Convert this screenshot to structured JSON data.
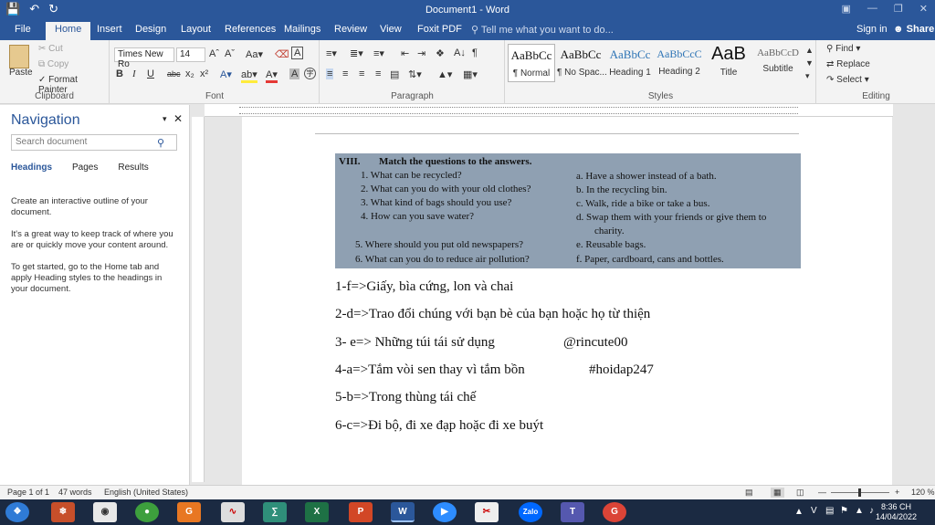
{
  "window": {
    "title": "Document1 - Word"
  },
  "quick_access": {
    "save_icon": "save-icon",
    "undo_icon": "undo-icon",
    "redo_icon": "redo-icon"
  },
  "tabs": [
    "File",
    "Home",
    "Insert",
    "Design",
    "Layout",
    "References",
    "Mailings",
    "Review",
    "View",
    "Foxit PDF"
  ],
  "tell_me": "Tell me what you want to do...",
  "signin": "Sign in",
  "share": "Share",
  "clipboard": {
    "paste": "Paste",
    "cut": "Cut",
    "copy": "Copy",
    "format_painter": "Format Painter",
    "label": "Clipboard"
  },
  "font": {
    "name": "Times New Ro",
    "size": "14",
    "label": "Font"
  },
  "paragraph": {
    "label": "Paragraph"
  },
  "styles": {
    "label": "Styles",
    "items": [
      {
        "sample": "AaBbCc",
        "name": "¶ Normal"
      },
      {
        "sample": "AaBbCc",
        "name": "¶ No Spac..."
      },
      {
        "sample": "AaBbCc",
        "name": "Heading 1"
      },
      {
        "sample": "AaBbCcC",
        "name": "Heading 2"
      },
      {
        "sample": "AaB",
        "name": "Title"
      },
      {
        "sample": "AaBbCcD",
        "name": "Subtitle"
      }
    ]
  },
  "editing": {
    "find": "Find",
    "replace": "Replace",
    "select": "Select",
    "label": "Editing"
  },
  "navigation": {
    "title": "Navigation",
    "search_placeholder": "Search document",
    "tabs": [
      "Headings",
      "Pages",
      "Results"
    ],
    "p1": "Create an interactive outline of your document.",
    "p2": "It's a great way to keep track of where you are or quickly move your content around.",
    "p3": "To get started, go to the Home tab and apply Heading styles to the headings in your document."
  },
  "photo": {
    "heading_num": "VIII.",
    "heading": "Match the questions to the answers.",
    "questions": [
      "1.   What can be recycled?",
      "2.   What can you do with your old clothes?",
      "3.   What kind of bags should you use?",
      "4.   How can you save water?",
      "5.   Where should you put old newspapers?",
      "6.   What can you do to reduce air pollution?"
    ],
    "answers": [
      "a.   Have a shower instead of a bath.",
      "b.   In the recycling bin.",
      "c.   Walk, ride a bike or take a bus.",
      "d.   Swap them with your friends or give them to",
      "charity.",
      "e.   Reusable bags.",
      "f.   Paper, cardboard, cans and bottles."
    ]
  },
  "document_lines": [
    "1-f=>Giấy, bìa cứng, lon và chai",
    "2-d=>Trao đổi chúng với bạn bè của bạn hoặc họ từ thiện",
    "3- e=> Những túi tái sử dụng",
    "4-a=>Tắm vòi sen thay vì tắm bồn",
    "5-b=>Trong thùng tái chế",
    "6-c=>Đi bộ, đi xe đạp hoặc đi xe buýt"
  ],
  "tags": {
    "tag1": "@rincute00",
    "tag2": "#hoidap247"
  },
  "status": {
    "page": "Page 1 of 1",
    "words": "47 words",
    "lang": "English (United States)",
    "zoom": "120 %"
  },
  "clock": {
    "time": "8:36 CH",
    "date": "14/04/2022"
  }
}
